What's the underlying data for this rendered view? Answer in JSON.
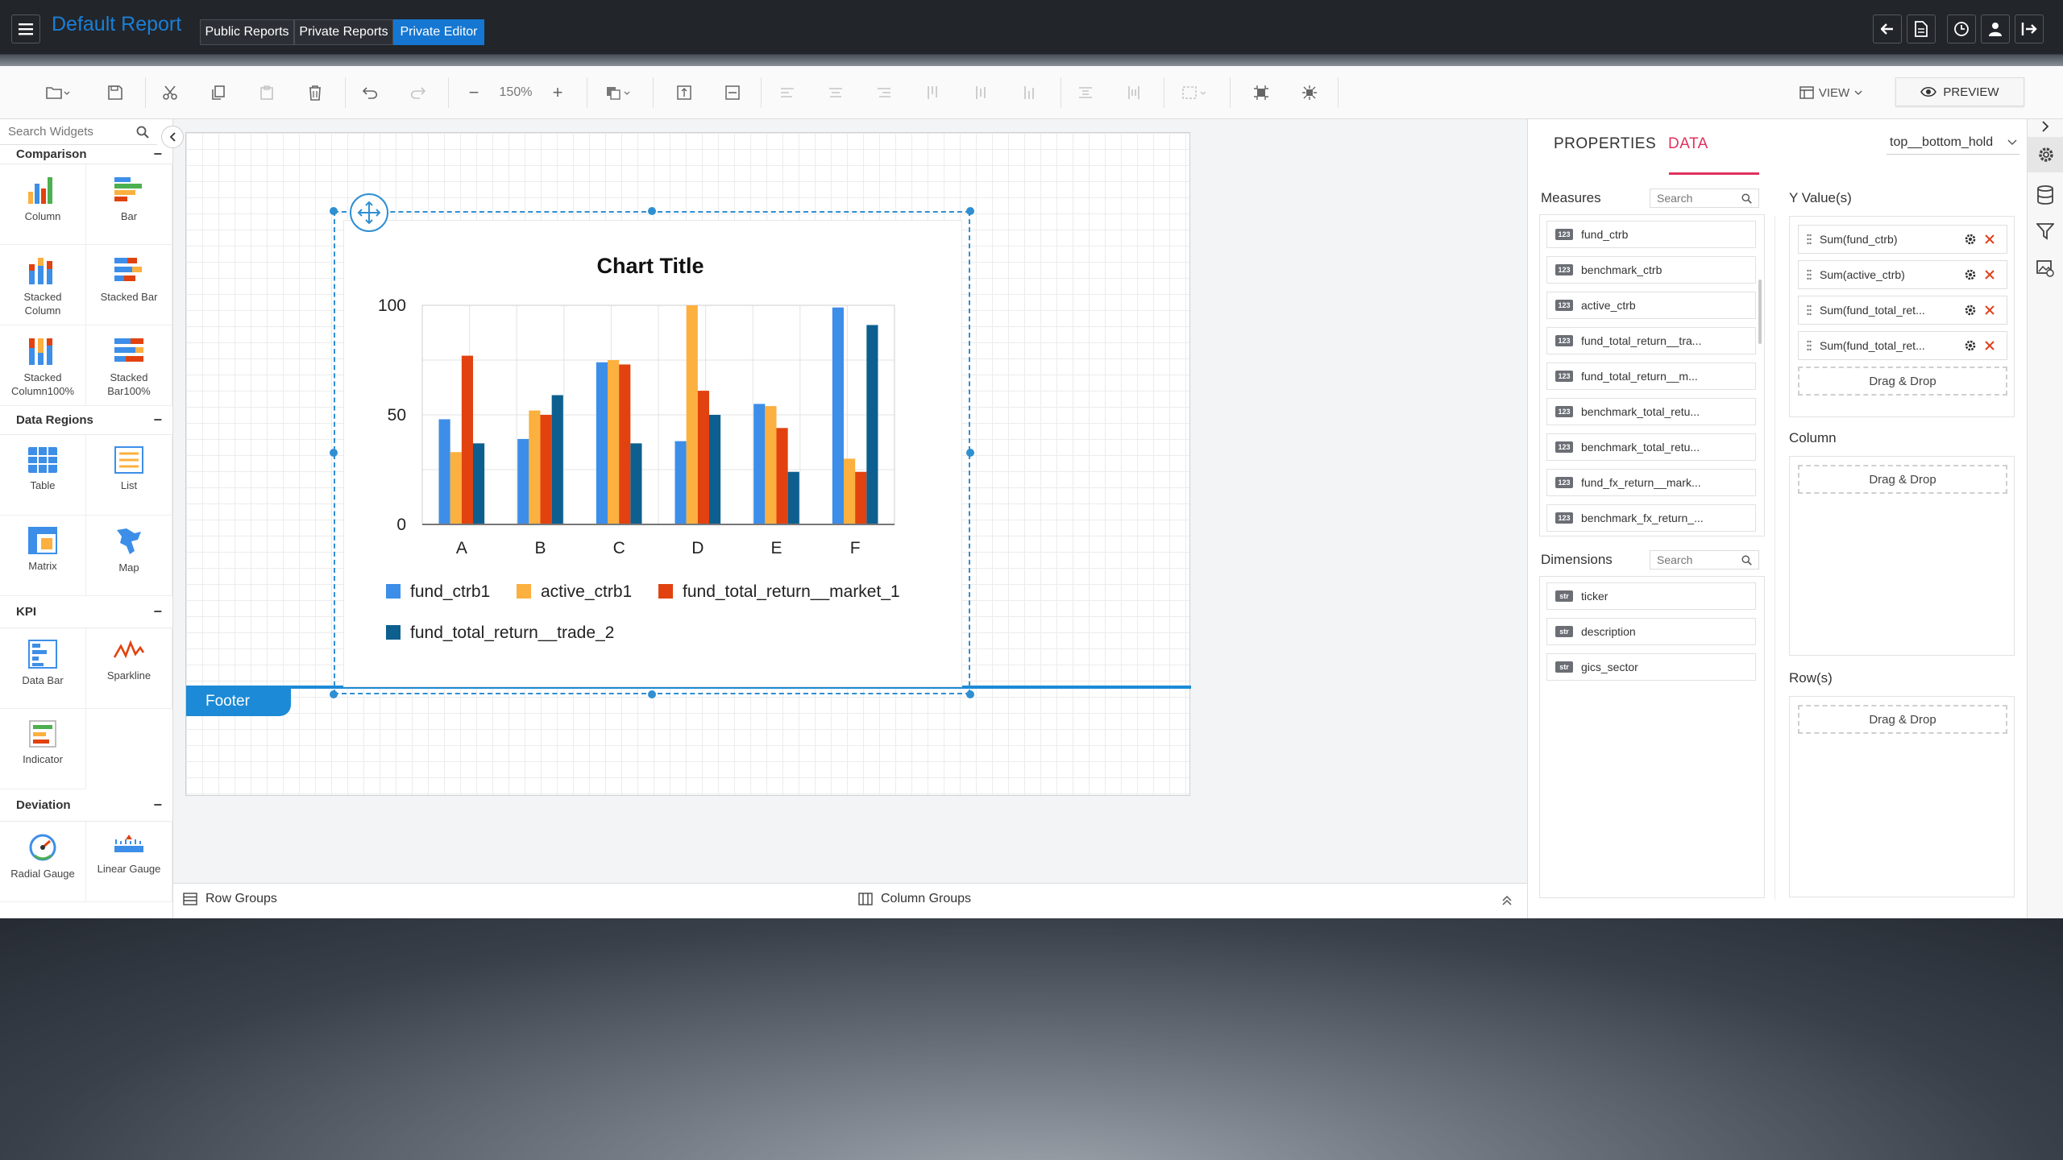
{
  "topbar": {
    "title": "Default Report",
    "tabs": [
      "Public Reports",
      "Private Reports",
      "Private Editor"
    ]
  },
  "toolbar": {
    "zoom": "150%",
    "view_label": "VIEW",
    "preview_label": "PREVIEW"
  },
  "widgets": {
    "search_placeholder": "Search Widgets",
    "sections": {
      "comparison": "Comparison",
      "data_regions": "Data Regions",
      "kpi": "KPI",
      "deviation": "Deviation"
    },
    "items": {
      "column": "Column",
      "bar": "Bar",
      "stacked_column": "Stacked Column",
      "stacked_bar": "Stacked Bar",
      "stacked_column100": "Stacked Column100%",
      "stacked_bar100": "Stacked Bar100%",
      "table": "Table",
      "list": "List",
      "matrix": "Matrix",
      "map": "Map",
      "data_bar": "Data Bar",
      "sparkline": "Sparkline",
      "indicator": "Indicator",
      "radial_gauge": "Radial Gauge",
      "linear_gauge": "Linear Gauge"
    }
  },
  "canvas": {
    "footer_label": "Footer"
  },
  "chart_data": {
    "type": "bar",
    "title": "Chart Title",
    "categories": [
      "A",
      "B",
      "C",
      "D",
      "E",
      "F"
    ],
    "ylim": [
      0,
      100
    ],
    "yticks": [
      0,
      50,
      100
    ],
    "grid": true,
    "legend": "bottom",
    "series": [
      {
        "name": "fund_ctrb1",
        "color": "#3d8ee8",
        "values": [
          48,
          39,
          74,
          38,
          55,
          99
        ]
      },
      {
        "name": "active_ctrb1",
        "color": "#fbb03f",
        "values": [
          33,
          52,
          75,
          100,
          54,
          30
        ]
      },
      {
        "name": "fund_total_return__market_1",
        "color": "#e1420f",
        "values": [
          77,
          50,
          73,
          61,
          44,
          24
        ]
      },
      {
        "name": "fund_total_return__trade_2",
        "color": "#0d5f8f",
        "values": [
          37,
          59,
          37,
          50,
          24,
          91
        ]
      }
    ]
  },
  "bottombar": {
    "row_groups": "Row Groups",
    "column_groups": "Column Groups"
  },
  "panel": {
    "tab_properties": "PROPERTIES",
    "tab_data": "DATA",
    "dataset": "top__bottom_hold",
    "measures_label": "Measures",
    "dimensions_label": "Dimensions",
    "search_placeholder": "Search",
    "measure_badge": "123",
    "dimension_badge": "str",
    "measures": [
      "fund_ctrb",
      "benchmark_ctrb",
      "active_ctrb",
      "fund_total_return__tra...",
      "fund_total_return__m...",
      "benchmark_total_retu...",
      "benchmark_total_retu...",
      "fund_fx_return__mark...",
      "benchmark_fx_return_..."
    ],
    "dimensions": [
      "ticker",
      "description",
      "gics_sector"
    ],
    "y_values_label": "Y Value(s)",
    "y_values": [
      "Sum(fund_ctrb)",
      "Sum(active_ctrb)",
      "Sum(fund_total_ret...",
      "Sum(fund_total_ret..."
    ],
    "column_label": "Column",
    "rows_label": "Row(s)",
    "drag_drop": "Drag & Drop"
  }
}
